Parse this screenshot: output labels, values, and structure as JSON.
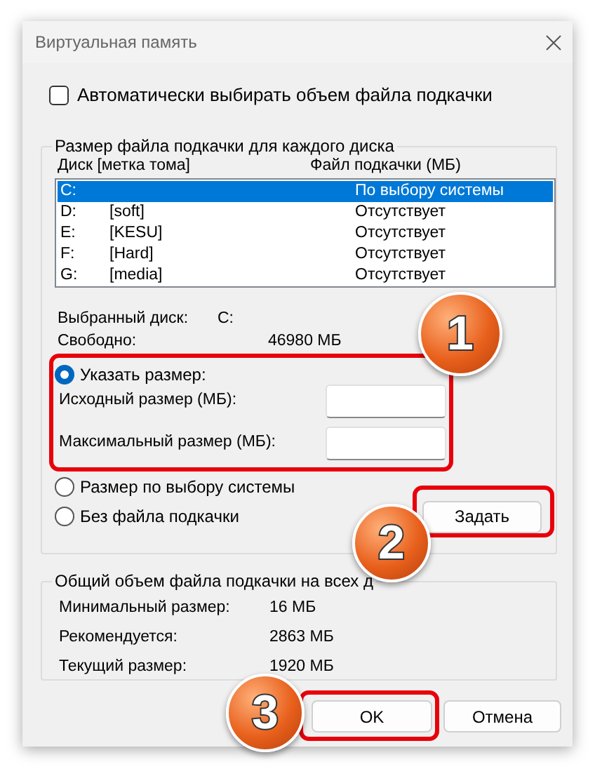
{
  "window": {
    "title": "Виртуальная память"
  },
  "auto_checkbox": {
    "label": "Автоматически выбирать объем файла подкачки",
    "checked": false
  },
  "per_disk_group": {
    "title": "Размер файла подкачки для каждого диска",
    "columns": [
      "Диск [метка тома]",
      "Файл подкачки (МБ)"
    ],
    "drives": [
      {
        "letter": "C:",
        "paging": "По выбору системы",
        "selected": true
      },
      {
        "letter": "D:",
        "label": "[soft]",
        "paging": "Отсутствует",
        "selected": false
      },
      {
        "letter": "E:",
        "label": "[KESU]",
        "paging": "Отсутствует",
        "selected": false
      },
      {
        "letter": "F:",
        "label": "[Hard]",
        "paging": "Отсутствует",
        "selected": false
      },
      {
        "letter": "G:",
        "label": "[media]",
        "paging": "Отсутствует",
        "selected": false
      }
    ],
    "selected_drive": {
      "label": "Выбранный диск:",
      "value": "C:"
    },
    "free_space": {
      "label": "Свободно:",
      "value": "46980 МБ"
    },
    "size_options": [
      {
        "kind": "custom",
        "label": "Указать размер:",
        "selected": true
      },
      {
        "kind": "system",
        "label": "Размер по выбору системы",
        "selected": false
      },
      {
        "kind": "none",
        "label": "Без файла подкачки",
        "selected": false
      }
    ],
    "size_fields": [
      {
        "label": "Исходный размер (МБ):"
      },
      {
        "label": "Максимальный размер (МБ):"
      }
    ],
    "set_button": "Задать"
  },
  "total_group": {
    "title": "Общий объем файла подкачки на всех д",
    "rows": [
      {
        "label": "Минимальный размер:",
        "value": "16 МБ"
      },
      {
        "label": "Рекомендуется:",
        "value": "2863 МБ"
      },
      {
        "label": "Текущий размер:",
        "value": "1920 МБ"
      }
    ]
  },
  "buttons": [
    "OK",
    "Отмена"
  ],
  "callouts": [
    {
      "number": "1"
    },
    {
      "number": "2"
    },
    {
      "number": "3"
    }
  ]
}
